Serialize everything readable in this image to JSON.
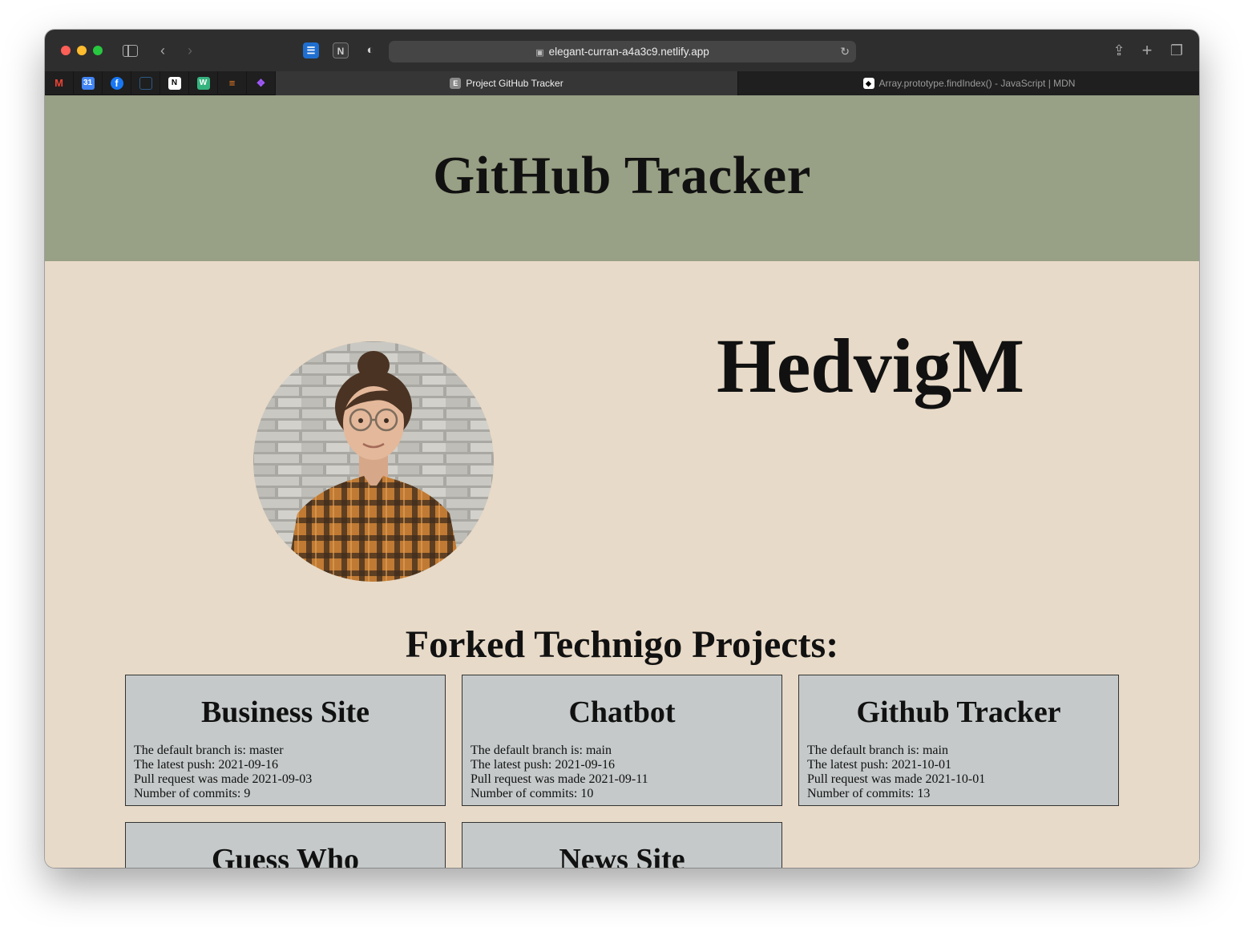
{
  "browser": {
    "url": "elegant-curran-a4a3c9.netlify.app",
    "tabs": [
      {
        "favicon": "E",
        "title": "Project GitHub Tracker",
        "active": true
      },
      {
        "favicon": "mdn-icon",
        "title": "Array.prototype.findIndex() - JavaScript | MDN",
        "active": false
      }
    ],
    "pinned_tabs": [
      "gmail-icon",
      "calendar-icon",
      "facebook-icon",
      "tab-icon",
      "notion-icon",
      "wave-icon",
      "stackoverflow-icon",
      "figma-icon"
    ],
    "calendar_day": "31"
  },
  "header": {
    "title": "GitHub Tracker"
  },
  "profile": {
    "username": "HedvigM"
  },
  "projects": {
    "heading": "Forked Technigo Projects:",
    "labels": {
      "branch": "The default branch is: ",
      "push": "The latest push: ",
      "pull": "Pull request was made ",
      "commits": "Number of commits: "
    },
    "items": [
      {
        "name": "Business Site",
        "branch": "master",
        "push": "2021-09-16",
        "pull": "2021-09-03",
        "commits": "9"
      },
      {
        "name": "Chatbot",
        "branch": "main",
        "push": "2021-09-16",
        "pull": "2021-09-11",
        "commits": "10"
      },
      {
        "name": "Github Tracker",
        "branch": "main",
        "push": "2021-10-01",
        "pull": "2021-10-01",
        "commits": "13"
      },
      {
        "name": "Guess Who",
        "branch": "",
        "push": "",
        "pull": "",
        "commits": ""
      },
      {
        "name": "News Site",
        "branch": "",
        "push": "",
        "pull": "",
        "commits": ""
      }
    ]
  },
  "colors": {
    "header_band": "#98a085",
    "page_bg": "#e8dac8",
    "card_bg": "#c5c9c9"
  }
}
